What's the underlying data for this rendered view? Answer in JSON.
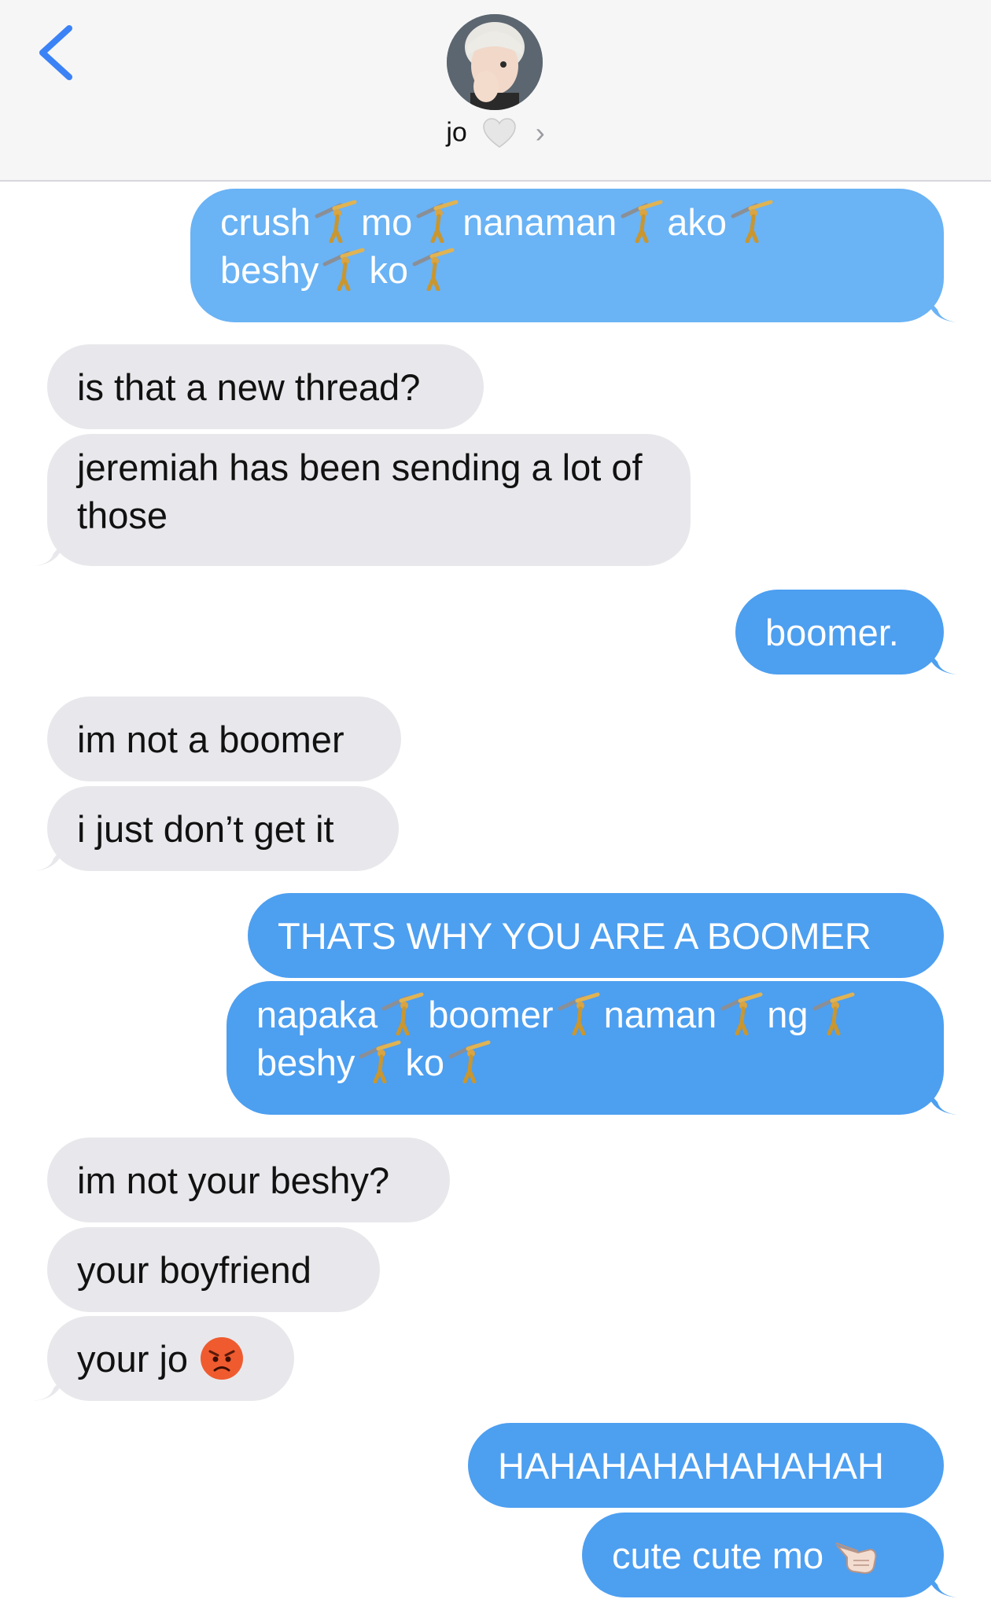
{
  "contact": {
    "name": "jo",
    "heart_icon": "white-heart-icon",
    "chevron": "›"
  },
  "messages": [
    {
      "id": 1,
      "from": "me",
      "lines": [
        [
          "crush",
          "mo",
          "nanaman",
          "ako"
        ],
        [
          "beshy",
          "ko"
        ]
      ],
      "emoji_between_words": "person-doing-cartwheel"
    },
    {
      "id": 2,
      "from": "them",
      "text": "is that a new thread?"
    },
    {
      "id": 3,
      "from": "them",
      "text": "jeremiah has been sending a lot of those"
    },
    {
      "id": 4,
      "from": "me",
      "text": "boomer."
    },
    {
      "id": 5,
      "from": "them",
      "text": "im not a boomer"
    },
    {
      "id": 6,
      "from": "them",
      "text": "i just don’t get it"
    },
    {
      "id": 7,
      "from": "me",
      "text": "THATS WHY YOU ARE A BOOMER"
    },
    {
      "id": 8,
      "from": "me",
      "lines": [
        [
          "napaka",
          "boomer",
          "naman",
          "ng"
        ],
        [
          "beshy",
          "ko"
        ]
      ],
      "emoji_between_words": "person-doing-cartwheel"
    },
    {
      "id": 9,
      "from": "them",
      "text": "im not your beshy?"
    },
    {
      "id": 10,
      "from": "them",
      "text": "your boyfriend"
    },
    {
      "id": 11,
      "from": "them",
      "text": "your jo",
      "emoji": "pouting-face"
    },
    {
      "id": 12,
      "from": "me",
      "text": "HAHAHAHAHAHAHAH"
    },
    {
      "id": 13,
      "from": "me",
      "text": "cute cute mo",
      "emoji": "pointing-hand"
    }
  ],
  "colors": {
    "sent": "#4d9ff0",
    "sent_light": "#6ab3f5",
    "received": "#e8e8ec",
    "accent": "#3b82f6"
  }
}
